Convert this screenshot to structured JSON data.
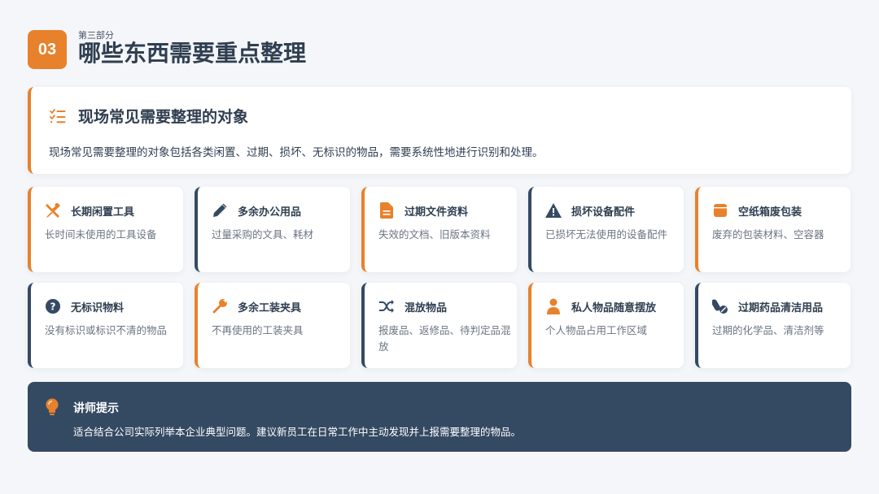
{
  "header": {
    "number": "03",
    "subtitle": "第三部分",
    "title": "哪些东西需要重点整理"
  },
  "intro": {
    "icon": "checklist-icon",
    "title": "现场常见需要整理的对象",
    "text": "现场常见需要整理的对象包括各类闲置、过期、损坏、无标识的物品，需要系统性地进行识别和处理。"
  },
  "cards": [
    {
      "icon": "tools-icon",
      "accent": "orange",
      "title": "长期闲置工具",
      "desc": "长时间未使用的工具设备"
    },
    {
      "icon": "pencil-icon",
      "accent": "navy",
      "title": "多余办公用品",
      "desc": "过量采购的文具、耗材"
    },
    {
      "icon": "document-icon",
      "accent": "orange",
      "title": "过期文件资料",
      "desc": "失效的文档、旧版本资料"
    },
    {
      "icon": "warning-icon",
      "accent": "navy",
      "title": "损坏设备配件",
      "desc": "已损坏无法使用的设备配件"
    },
    {
      "icon": "box-icon",
      "accent": "orange",
      "title": "空纸箱废包装",
      "desc": "废弃的包装材料、空容器"
    },
    {
      "icon": "question-icon",
      "accent": "navy",
      "title": "无标识物料",
      "desc": "没有标识或标识不清的物品"
    },
    {
      "icon": "wrench-icon",
      "accent": "orange",
      "title": "多余工装夹具",
      "desc": "不再使用的工装夹具"
    },
    {
      "icon": "shuffle-icon",
      "accent": "navy",
      "title": "混放物品",
      "desc": "报废品、返修品、待判定品混放"
    },
    {
      "icon": "person-icon",
      "accent": "orange",
      "title": "私人物品随意摆放",
      "desc": "个人物品占用工作区域"
    },
    {
      "icon": "pills-icon",
      "accent": "navy",
      "title": "过期药品清洁用品",
      "desc": "过期的化学品、清洁剂等"
    }
  ],
  "tip": {
    "icon": "lightbulb-icon",
    "title": "讲师提示",
    "text": "适合结合公司实际列举本企业典型问题。建议新员工在日常工作中主动发现并上报需要整理的物品。"
  },
  "colors": {
    "accent": "#e8812c",
    "navy": "#344a63",
    "background": "#f4f6f9"
  }
}
